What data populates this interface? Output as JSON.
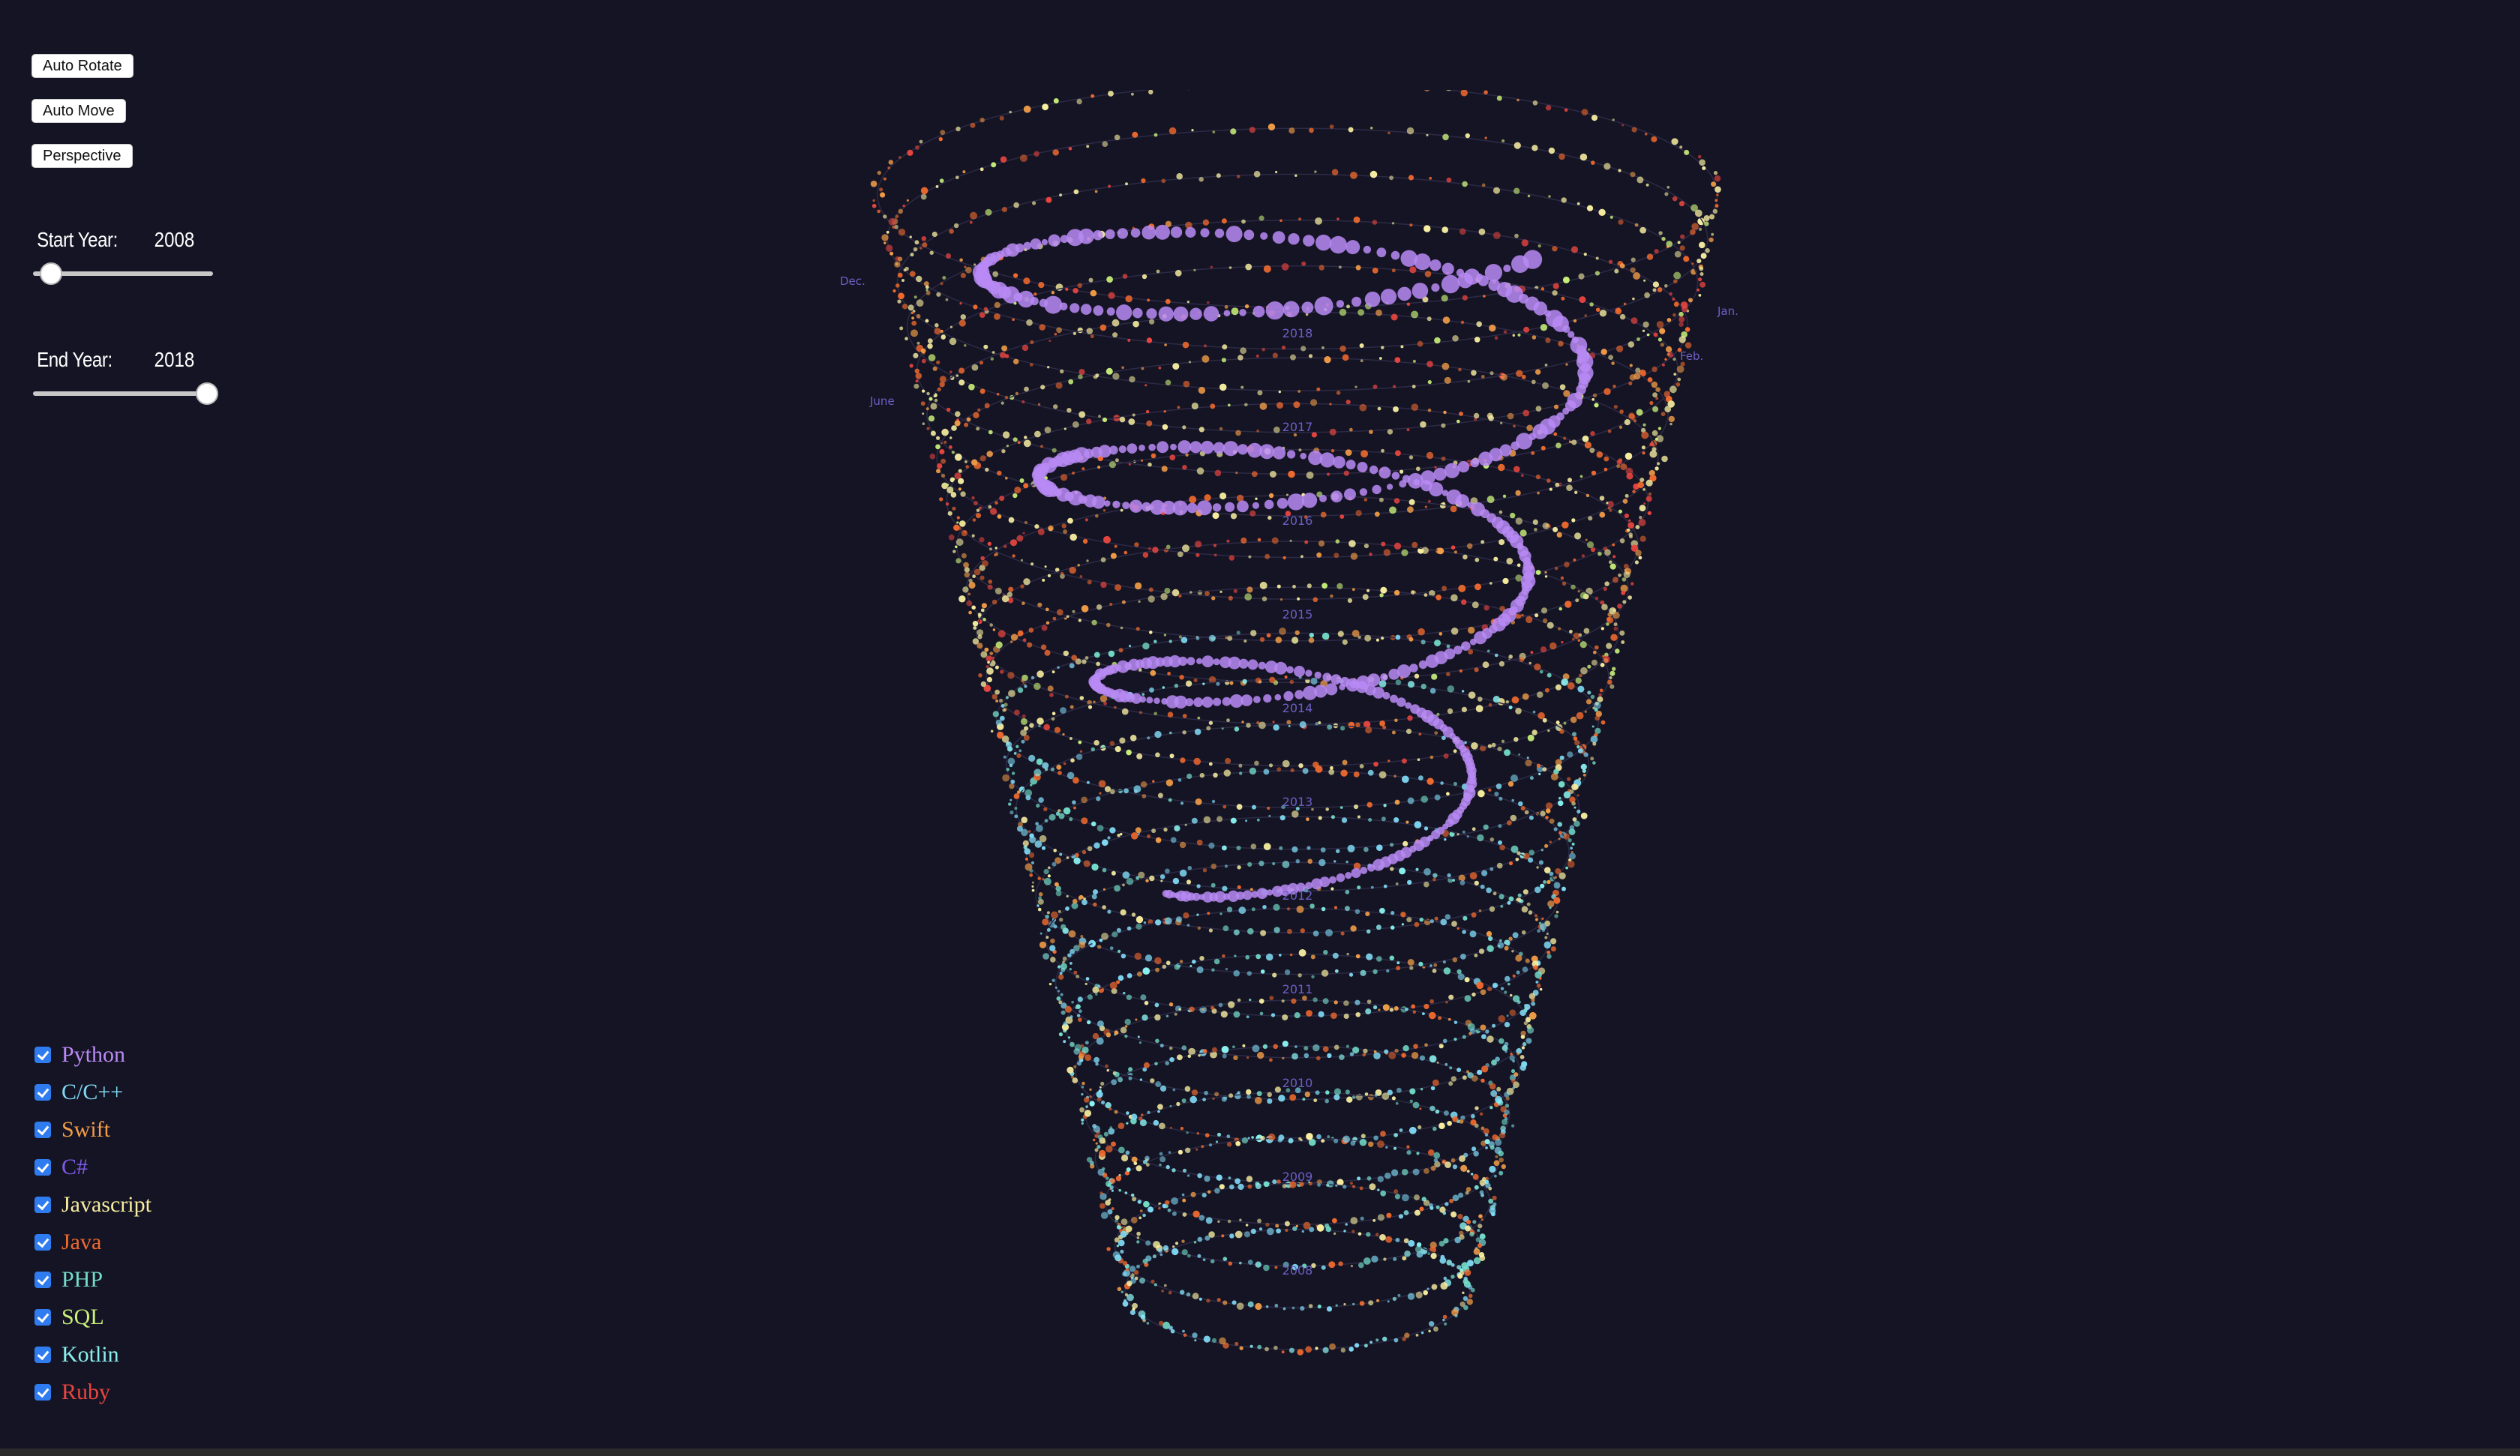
{
  "controls": {
    "auto_rotate_label": "Auto Rotate",
    "auto_move_label": "Auto Move",
    "perspective_label": "Perspective"
  },
  "sliders": {
    "start": {
      "label": "Start Year:",
      "value": "2008",
      "min": 2008,
      "max": 2018,
      "current": 2008
    },
    "end": {
      "label": "End Year:",
      "value": "2018",
      "min": 2008,
      "max": 2018,
      "current": 2018
    }
  },
  "legend": [
    {
      "name": "Python",
      "color": "#b98af5",
      "checked": true
    },
    {
      "name": "C/C++",
      "color": "#7fd8f2",
      "checked": true
    },
    {
      "name": "Swift",
      "color": "#f29d47",
      "checked": true
    },
    {
      "name": "C#",
      "color": "#7d5be6",
      "checked": true
    },
    {
      "name": "Javascript",
      "color": "#f7eea0",
      "checked": true
    },
    {
      "name": "Java",
      "color": "#f06a2e",
      "checked": true
    },
    {
      "name": "PHP",
      "color": "#73ddc9",
      "checked": true
    },
    {
      "name": "SQL",
      "color": "#c9f07a",
      "checked": true
    },
    {
      "name": "Kotlin",
      "color": "#8af0ee",
      "checked": true
    },
    {
      "name": "Ruby",
      "color": "#e9463f",
      "checked": true
    }
  ],
  "visualization": {
    "type": "3D spiral of monthly language activity",
    "years": [
      "2018",
      "2017",
      "2016",
      "2015",
      "2014",
      "2013",
      "2012",
      "2011",
      "2010",
      "2009",
      "2008"
    ],
    "month_labels": [
      "Jan.",
      "Feb.",
      "Dec.",
      "June"
    ],
    "background": "#151424"
  }
}
